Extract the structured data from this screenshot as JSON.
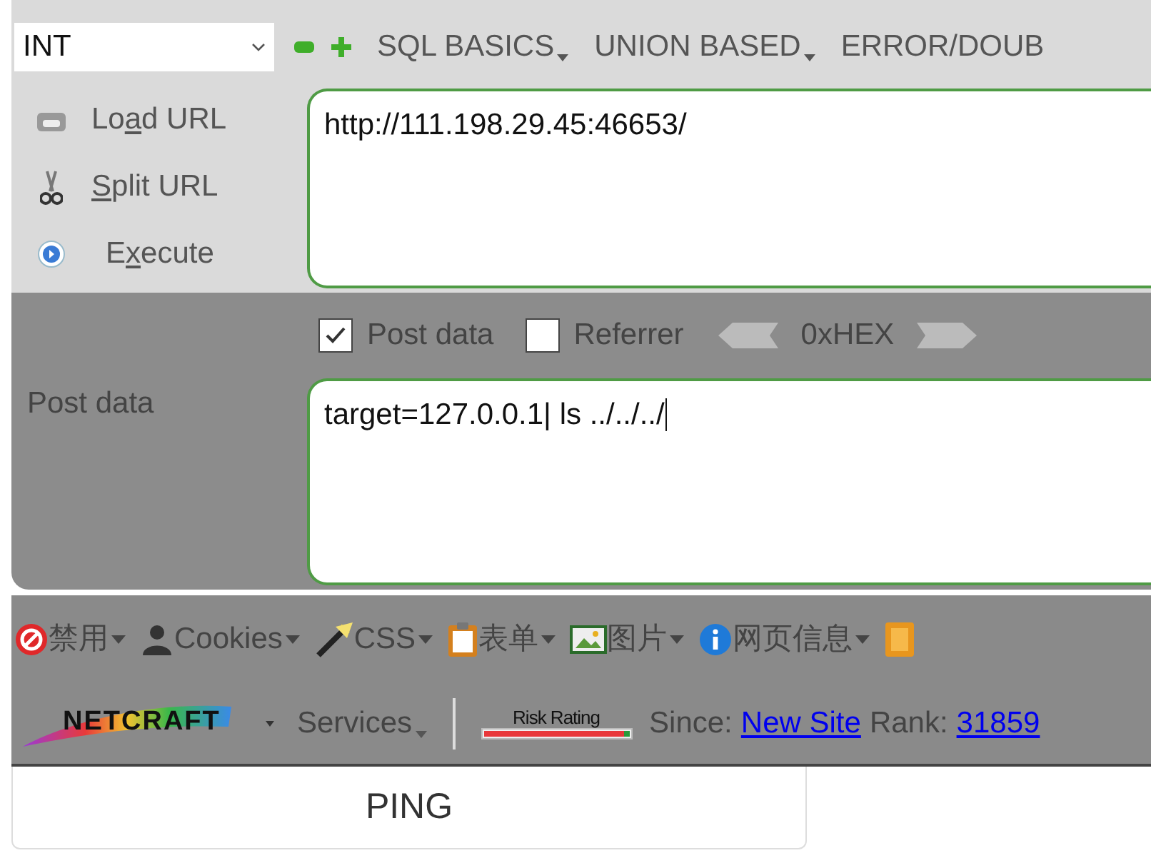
{
  "hackbar": {
    "select": {
      "value": "INT"
    },
    "menu": [
      {
        "label": "SQL BASICS",
        "dropdown": true
      },
      {
        "label": "UNION BASED",
        "dropdown": true
      },
      {
        "label": "ERROR/DOUB",
        "dropdown": false
      }
    ],
    "actions": [
      {
        "kind": "load",
        "text_before": "Lo",
        "key": "a",
        "text_after": "d URL"
      },
      {
        "kind": "split",
        "key": "S",
        "text_after": "plit URL"
      },
      {
        "kind": "execute",
        "text_before": "E",
        "key": "x",
        "text_after": "ecute"
      }
    ],
    "url": "http://111.198.29.45:46653/",
    "options": [
      {
        "label": "Post data",
        "checked": true
      },
      {
        "label": "Referrer",
        "checked": false
      }
    ],
    "hex_label": "0xHEX",
    "post_label": "Post data",
    "post_value": "target=127.0.0.1| ls ../../../"
  },
  "toolbar": [
    {
      "kind": "disable",
      "label": "禁用"
    },
    {
      "kind": "cookies",
      "label": "Cookies"
    },
    {
      "kind": "css",
      "label": "CSS"
    },
    {
      "kind": "form",
      "label": "表单"
    },
    {
      "kind": "image",
      "label": "图片"
    },
    {
      "kind": "info",
      "label": "网页信息"
    },
    {
      "kind": "book"
    }
  ],
  "netcraft": {
    "logo": "NETCRAFT",
    "services": "Services",
    "risk_label": "Risk Rating",
    "since_label": "Since:",
    "since_link": "New Site",
    "rank_label": "Rank:",
    "rank_link": "31859"
  },
  "button": {
    "label": "PING"
  }
}
